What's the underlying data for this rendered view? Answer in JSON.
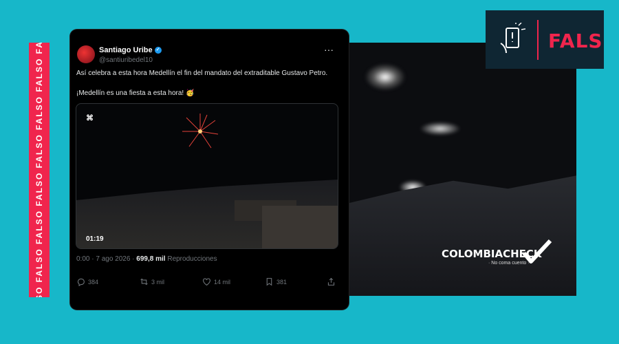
{
  "side_strip": {
    "text": "FALSO FALSO FALSO FALSO FALSO FALSO FALSO FALSO"
  },
  "tweet": {
    "name": "Santiago Uribe",
    "handle": "@santiuribedel10",
    "more": "···",
    "text1": "Así celebra a esta hora Medellín el fin del mandato del extraditable Gustavo Petro.",
    "text2": "¡Medellín es una fiesta a esta hora! 🥳",
    "media": {
      "app_logo": "⌘",
      "duration": "01:19"
    },
    "meta": {
      "time": "0:00 · 7 ago 2026 · ",
      "views_count": "699,8 mil",
      "views_label": " Reproducciones"
    },
    "actions": {
      "replies": "384",
      "reposts": "3 mil",
      "likes": "14 mil",
      "bookmarks": "381"
    }
  },
  "badge": {
    "label": "FALSO",
    "accent": "#f0254d",
    "background": "#0f2633"
  },
  "brand": {
    "title": "COLOMBIACHECK",
    "tagline": "· No coma cuento ·"
  },
  "colors": {
    "page_background": "#17b7c9",
    "tweet_background": "#000000"
  }
}
